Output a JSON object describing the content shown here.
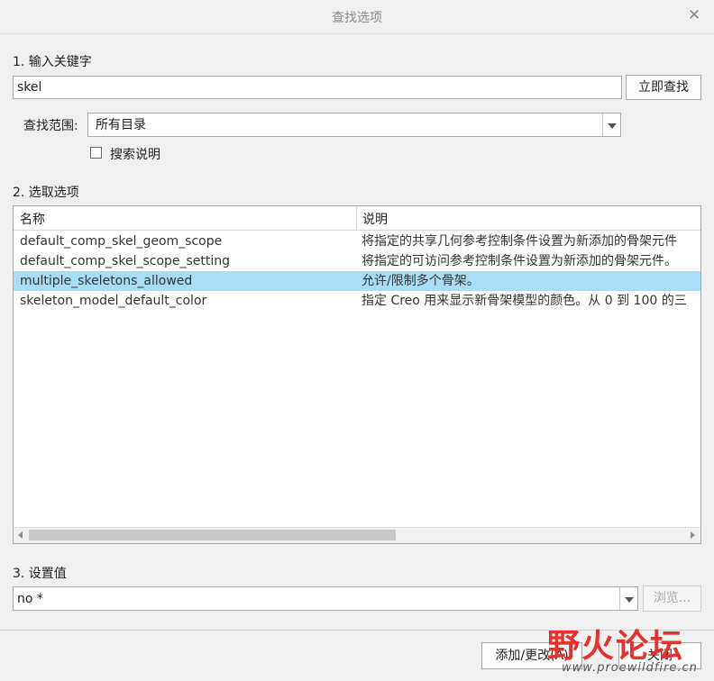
{
  "window": {
    "title": "查找选项"
  },
  "section1": {
    "label": "1. 输入关键字"
  },
  "keyword": {
    "value": "skel"
  },
  "find_button": {
    "label": "立即查找"
  },
  "scope": {
    "label": "查找范围:",
    "value": "所有目录"
  },
  "search_desc": {
    "label": "搜索说明",
    "checked": false
  },
  "section2": {
    "label": "2. 选取选项"
  },
  "table": {
    "columns": [
      "名称",
      "说明"
    ],
    "rows": [
      {
        "name": "default_comp_skel_geom_scope",
        "desc": "将指定的共享几何参考控制条件设置为新添加的骨架元件"
      },
      {
        "name": "default_comp_skel_scope_setting",
        "desc": "将指定的可访问参考控制条件设置为新添加的骨架元件。"
      },
      {
        "name": "multiple_skeletons_allowed",
        "desc": "允许/限制多个骨架。",
        "selected": true
      },
      {
        "name": "skeleton_model_default_color",
        "desc": "指定 Creo 用来显示新骨架模型的颜色。从 0 到 100 的三"
      }
    ]
  },
  "section3": {
    "label": "3. 设置值"
  },
  "value": {
    "value": "no *"
  },
  "browse_button": {
    "label": "浏览..."
  },
  "add_button": {
    "label": "添加/更改(A)"
  },
  "close_button": {
    "label": "关闭"
  },
  "watermark": {
    "brand": "野火论坛",
    "url": "www.proewildfire.cn"
  },
  "colors": {
    "selection": "#a9dcf7",
    "watermark_red": "#e2332e",
    "watermark_dark": "#222222"
  }
}
